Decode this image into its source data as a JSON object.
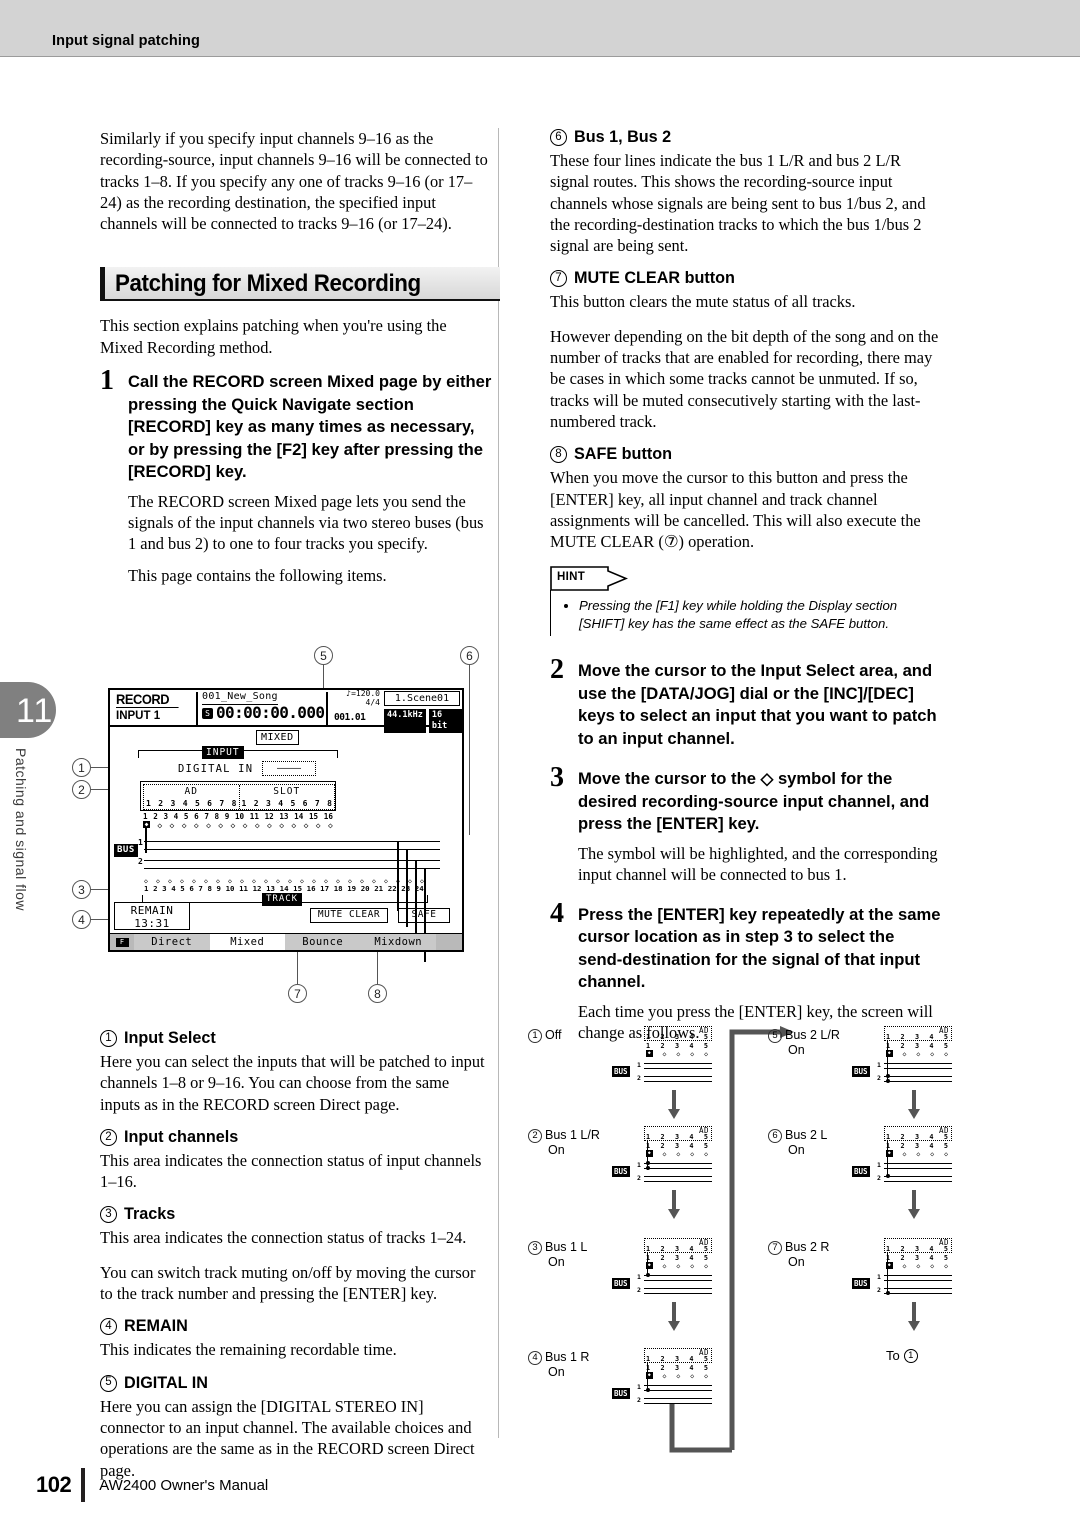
{
  "header": {
    "title": "Input signal patching"
  },
  "chapter": {
    "number": "11",
    "label": "Patching and signal flow"
  },
  "footer": {
    "page": "102",
    "manual": "AW2400  Owner's Manual"
  },
  "left": {
    "intro": "Similarly if you specify input channels 9–16 as the recording-source, input channels 9–16 will be connected to tracks 1–8. If you specify any one of tracks 9–16 (or 17–24) as the recording destination, the specified input channels will be connected to tracks 9–16 (or 17–24).",
    "section_title": "Patching for Mixed Recording",
    "section_intro": "This section explains patching when you're using the Mixed Recording method.",
    "step1": {
      "num": "1",
      "title": "Call the RECORD screen Mixed page by either pressing the Quick Navigate section [RECORD] key as many times as necessary, or by pressing the [F2] key after pressing the [RECORD] key.",
      "p1": "The RECORD screen Mixed page lets you send the signals of the input channels via two stereo buses (bus 1 and bus 2) to one to four tracks you specify.",
      "p2": "This page contains the following items."
    },
    "items": [
      {
        "n": "1",
        "label": "Input Select",
        "body": [
          "Here you can select the inputs that will be patched to input channels 1–8 or 9–16. You can choose from the same inputs as in the RECORD screen Direct page."
        ]
      },
      {
        "n": "2",
        "label": "Input channels",
        "body": [
          "This area indicates the connection status of input channels 1–16."
        ]
      },
      {
        "n": "3",
        "label": "Tracks",
        "body": [
          "This area indicates the connection status of tracks 1–24.",
          "You can switch track muting on/off by moving the cursor to the track number and pressing the [ENTER] key."
        ]
      },
      {
        "n": "4",
        "label": "REMAIN",
        "body": [
          "This indicates the remaining recordable time."
        ]
      },
      {
        "n": "5",
        "label": "DIGITAL IN",
        "body": [
          "Here you can assign the [DIGITAL STEREO IN] connector to an input channel. The available choices and operations are the same as in the RECORD screen Direct page."
        ]
      }
    ]
  },
  "right": {
    "items": [
      {
        "n": "6",
        "label": "Bus 1, Bus 2",
        "body": [
          "These four lines indicate the bus 1 L/R and bus 2 L/R signal routes. This shows the recording-source input channels whose signals are being sent to bus 1/bus 2, and the recording-destination tracks to which the bus 1/bus 2 signal are being sent."
        ]
      },
      {
        "n": "7",
        "label": "MUTE CLEAR button",
        "body": [
          "This button clears the mute status of all tracks.",
          "However depending on the bit depth of the song and on the number of tracks that are enabled for recording, there may be cases in which some tracks cannot be unmuted. If so, tracks will be muted consecutively starting with the last-numbered track."
        ]
      },
      {
        "n": "8",
        "label": "SAFE button",
        "body": [
          "When you move the cursor to this button and press the [ENTER] key, all input channel and track channel assignments will be cancelled. This will also execute the MUTE CLEAR (⑦) operation."
        ]
      }
    ],
    "hint": {
      "label": "HINT",
      "text": "Pressing the [F1] key while holding the Display section [SHIFT] key has the same effect as the SAFE button."
    },
    "step2": {
      "num": "2",
      "title": "Move the cursor to the Input Select area, and use the [DATA/JOG] dial or the [INC]/[DEC] keys to select an input that you want to patch to an input channel."
    },
    "step3": {
      "num": "3",
      "title_a": "Move the cursor to the ",
      "title_sym": "◇",
      "title_b": " symbol for the desired recording-source input channel, and press the [ENTER] key.",
      "p1": "The symbol will be highlighted, and the corresponding input channel will be connected to bus 1."
    },
    "step4": {
      "num": "4",
      "title": "Press the [ENTER] key repeatedly at the same cursor location as in step 3 to select the send-destination for the signal of that input channel.",
      "p1": "Each time you press the [ENTER] key, the screen will change as follows."
    }
  },
  "lcd": {
    "mode_line1": "RECORD",
    "mode_line2": "INPUT 1",
    "song": "001_New_Song",
    "shuttle_icon": "S",
    "time": "00:00:00.000",
    "tempo": "♪=120.0",
    "meter": "4/4",
    "measure": "001.01",
    "scene": "1.Scene01",
    "samplerate": "44.1kHz",
    "bitdepth": "16 bit",
    "mixed_badge": "MIXED",
    "input_label": "INPUT",
    "digital_in_label": "DIGITAL IN",
    "digital_in_value": "––––",
    "ad_label": "AD",
    "slot_label": "SLOT",
    "ad_nums": [
      "1",
      "2",
      "3",
      "4",
      "5",
      "6",
      "7",
      "8"
    ],
    "slot_nums": [
      "1",
      "2",
      "3",
      "4",
      "5",
      "6",
      "7",
      "8"
    ],
    "channel_nums": [
      "1",
      "2",
      "3",
      "4",
      "5",
      "6",
      "7",
      "8",
      "9",
      "10",
      "11",
      "12",
      "13",
      "14",
      "15",
      "16"
    ],
    "bus_label": "BUS",
    "bus_nums": [
      "1",
      "2"
    ],
    "track_nums": [
      "1",
      "2",
      "3",
      "4",
      "5",
      "6",
      "7",
      "8",
      "9",
      "10",
      "11",
      "12",
      "13",
      "14",
      "15",
      "16",
      "17",
      "18",
      "19",
      "20",
      "21",
      "22",
      "23",
      "24"
    ],
    "track_label": "TRACK",
    "remain_label": "REMAIN",
    "remain_value": "13:31",
    "mute_clear_btn": "MUTE CLEAR",
    "safe_btn": "SAFE",
    "tabs": [
      "Direct",
      "Mixed",
      "Bounce",
      "Mixdown"
    ],
    "selected_tab": "Mixed",
    "f_key": "F",
    "callouts": [
      "1",
      "2",
      "3",
      "4",
      "5",
      "6",
      "7",
      "8"
    ]
  },
  "flow": {
    "steps": [
      {
        "n": "1",
        "line1": "Off",
        "line2": ""
      },
      {
        "n": "2",
        "line1": "Bus 1 L/R",
        "line2": "On"
      },
      {
        "n": "3",
        "line1": "Bus 1 L",
        "line2": "On"
      },
      {
        "n": "4",
        "line1": "Bus 1 R",
        "line2": "On"
      },
      {
        "n": "5",
        "line1": "Bus 2 L/R",
        "line2": "On"
      },
      {
        "n": "6",
        "line1": "Bus 2 L",
        "line2": "On"
      },
      {
        "n": "7",
        "line1": "Bus 2 R",
        "line2": "On"
      }
    ],
    "mini_ad_label": "AD",
    "mini_nums": [
      "1",
      "2",
      "3",
      "4",
      "5"
    ],
    "mini_bus_label": "BUS",
    "mini_bus_nums": [
      "1",
      "2"
    ],
    "return_label": "To",
    "return_target": "1"
  }
}
